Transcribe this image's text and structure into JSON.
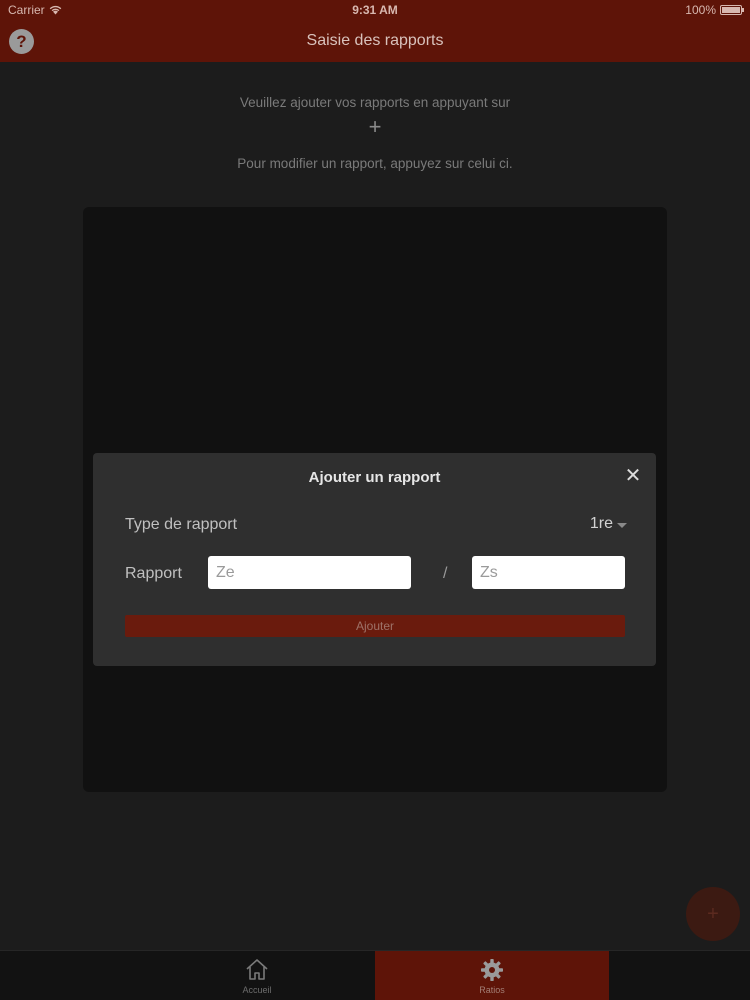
{
  "status_bar": {
    "carrier": "Carrier",
    "time": "9:31 AM",
    "battery": "100%",
    "battery_level": 1.0
  },
  "nav": {
    "title": "Saisie des rapports",
    "help_label": "?"
  },
  "instructions": {
    "line1": "Veuillez ajouter vos rapports en appuyant sur",
    "plus": "+",
    "line2": "Pour modifier un rapport, appuyez sur celui ci."
  },
  "dialog": {
    "title": "Ajouter un rapport",
    "close": "✕",
    "type_label": "Type de rapport",
    "type_value": "1re",
    "ratio_label": "Rapport",
    "ze_placeholder": "Ze",
    "zs_placeholder": "Zs",
    "separator": "/",
    "add_label": "Ajouter"
  },
  "fab": {
    "label": "+"
  },
  "tabs": [
    {
      "label": "Accueil",
      "icon": "home-icon",
      "selected": false
    },
    {
      "label": "Ratios",
      "icon": "gear-icon",
      "selected": true
    }
  ],
  "colors": {
    "accent": "#5e1408",
    "background": "#1c1c1c",
    "dialog": "#2f2f2f"
  }
}
